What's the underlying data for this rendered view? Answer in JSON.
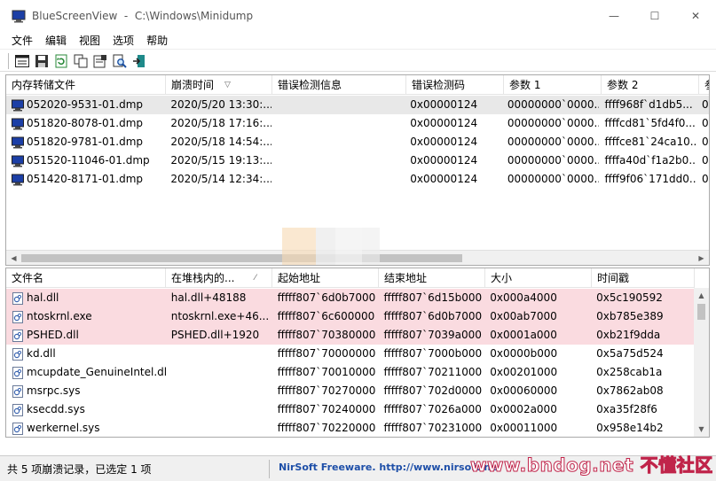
{
  "window": {
    "title": "BlueScreenView  -  C:\\Windows\\Minidump",
    "minimize": "—",
    "maximize": "☐",
    "close": "✕"
  },
  "menu": [
    "文件",
    "编辑",
    "视图",
    "选项",
    "帮助"
  ],
  "toolbar": [
    "html-report-icon",
    "save-icon",
    "refresh-icon",
    "copy-icon",
    "properties-icon",
    "find-icon",
    "exit-icon"
  ],
  "upper": {
    "columns": [
      "内存转储文件",
      "崩溃时间",
      "错误检测信息",
      "错误检测码",
      "参数 1",
      "参数 2",
      "参"
    ],
    "sort_glyph": "▽",
    "rows": [
      {
        "file": "052020-9531-01.dmp",
        "time": "2020/5/20 13:30:...",
        "info": "",
        "code": "0x00000124",
        "p1": "00000000`0000...",
        "p2": "ffff968f`d1db5...",
        "p3": "0",
        "selected": true
      },
      {
        "file": "051820-8078-01.dmp",
        "time": "2020/5/18 17:16:...",
        "info": "",
        "code": "0x00000124",
        "p1": "00000000`0000...",
        "p2": "ffffcd81`5fd4f0...",
        "p3": "0",
        "selected": false
      },
      {
        "file": "051820-9781-01.dmp",
        "time": "2020/5/18 14:54:...",
        "info": "",
        "code": "0x00000124",
        "p1": "00000000`0000...",
        "p2": "ffffce81`24ca10...",
        "p3": "0",
        "selected": false
      },
      {
        "file": "051520-11046-01.dmp",
        "time": "2020/5/15 19:13:...",
        "info": "",
        "code": "0x00000124",
        "p1": "00000000`0000...",
        "p2": "ffffa40d`f1a2b0...",
        "p3": "0",
        "selected": false
      },
      {
        "file": "051420-8171-01.dmp",
        "time": "2020/5/14 12:34:...",
        "info": "",
        "code": "0x00000124",
        "p1": "00000000`0000...",
        "p2": "ffff9f06`171dd0...",
        "p3": "0",
        "selected": false
      }
    ]
  },
  "lower": {
    "columns": [
      "文件名",
      "在堆栈内的...",
      "起始地址",
      "结束地址",
      "大小",
      "时间戳"
    ],
    "sort_glyph": "⁄",
    "rows": [
      {
        "name": "hal.dll",
        "stack": "hal.dll+48188",
        "start": "fffff807`6d0b7000",
        "end": "fffff807`6d15b000",
        "size": "0x000a4000",
        "ts": "0x5c190592",
        "highlight": true
      },
      {
        "name": "ntoskrnl.exe",
        "stack": "ntoskrnl.exe+46...",
        "start": "fffff807`6c600000",
        "end": "fffff807`6d0b7000",
        "size": "0x00ab7000",
        "ts": "0xb785e389",
        "highlight": true
      },
      {
        "name": "PSHED.dll",
        "stack": "PSHED.dll+1920",
        "start": "fffff807`70380000",
        "end": "fffff807`7039a000",
        "size": "0x0001a000",
        "ts": "0xb21f9dda",
        "highlight": true
      },
      {
        "name": "kd.dll",
        "stack": "",
        "start": "fffff807`70000000",
        "end": "fffff807`7000b000",
        "size": "0x0000b000",
        "ts": "0x5a75d524",
        "highlight": false
      },
      {
        "name": "mcupdate_GenuineIntel.dll",
        "stack": "",
        "start": "fffff807`70010000",
        "end": "fffff807`70211000",
        "size": "0x00201000",
        "ts": "0x258cab1a",
        "highlight": false
      },
      {
        "name": "msrpc.sys",
        "stack": "",
        "start": "fffff807`70270000",
        "end": "fffff807`702d0000",
        "size": "0x00060000",
        "ts": "0x7862ab08",
        "highlight": false
      },
      {
        "name": "ksecdd.sys",
        "stack": "",
        "start": "fffff807`70240000",
        "end": "fffff807`7026a000",
        "size": "0x0002a000",
        "ts": "0xa35f28f6",
        "highlight": false
      },
      {
        "name": "werkernel.sys",
        "stack": "",
        "start": "fffff807`70220000",
        "end": "fffff807`70231000",
        "size": "0x00011000",
        "ts": "0x958e14b2",
        "highlight": false
      }
    ]
  },
  "status": {
    "left": "共 5 项崩溃记录，已选定 1 项",
    "link": "NirSoft Freeware.  http://www.nirsoft.ne"
  },
  "watermark": "www.bndog.net 不懂社区",
  "colors": {
    "highlight_row": "#fadbe0",
    "selected_row": "#e8e8e8",
    "link": "#1e4fa8",
    "watermark_stroke": "#c0244a"
  }
}
